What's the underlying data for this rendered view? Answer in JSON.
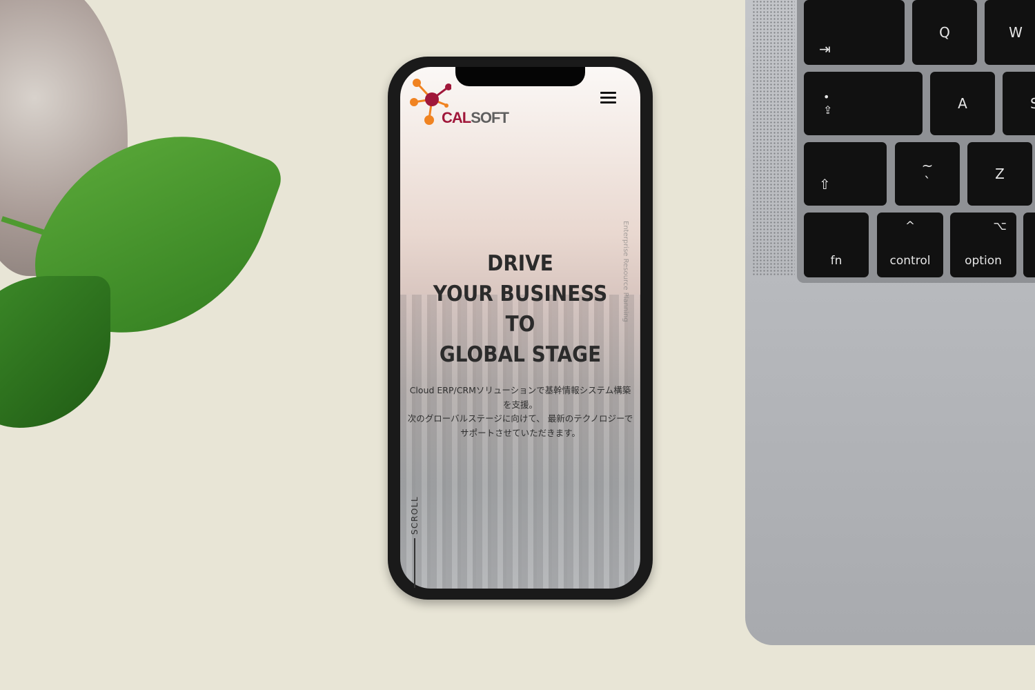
{
  "site": {
    "brand_left": "CAL",
    "brand_right": "SOFT",
    "brand_colors": {
      "cal": "#a0173a",
      "soft": "#5f5f5f",
      "orange": "#f08321"
    },
    "menu_icon": "hamburger-icon",
    "headline": [
      "DRIVE",
      "YOUR BUSINESS",
      "TO",
      "GLOBAL STAGE"
    ],
    "description": [
      "Cloud ERP/CRMソリューションで基幹情報システム構築を支援。",
      "次のグローバルステージに向けて、 最新のテクノロジーでサポートさせていただきます。"
    ],
    "vertical_text": "Enterprise Resource Planning",
    "scroll_label": "SCROLL"
  },
  "keyboard": {
    "keys": [
      "Q",
      "W",
      "A",
      "S",
      "Z",
      "fn",
      "control",
      "option"
    ],
    "tab_icon": "tab-arrow-icon",
    "caps_icon": "caps-lock-icon",
    "shift_icon": "shift-icon",
    "tilde": "~",
    "backtick": "`",
    "ctrl_icon": "^",
    "option_icon": "⌥"
  }
}
